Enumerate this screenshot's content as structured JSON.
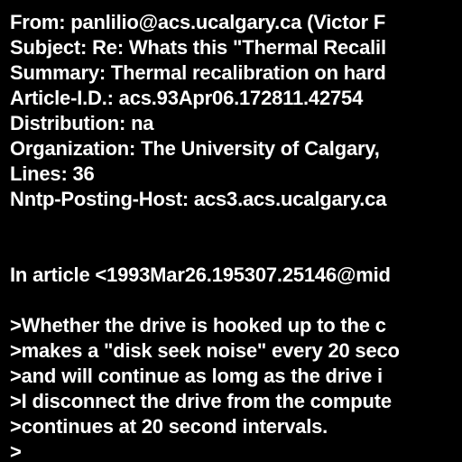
{
  "headers": {
    "from": "From: panlilio@acs.ucalgary.ca (Victor F",
    "subject": "Subject: Re: Whats this \"Thermal Recalil",
    "summary": "Summary: Thermal recalibration on hard",
    "article_id": "Article-I.D.: acs.93Apr06.172811.42754",
    "distribution": "Distribution: na",
    "organization": "Organization: The University of Calgary,",
    "lines": "Lines: 36",
    "nntp_posting_host": "Nntp-Posting-Host: acs3.acs.ucalgary.ca"
  },
  "body": {
    "attribution": "In article <1993Mar26.195307.25146@mid",
    "quoted_lines": [
      ">Whether the drive is hooked up to the c",
      ">makes a \"disk seek noise\" every 20 seco",
      ">and will continue as lomg as the drive i",
      ">I disconnect the drive from the compute",
      ">continues at 20 second intervals.",
      ">"
    ]
  },
  "colors": {
    "background": "#000000",
    "text": "#ffffff"
  }
}
